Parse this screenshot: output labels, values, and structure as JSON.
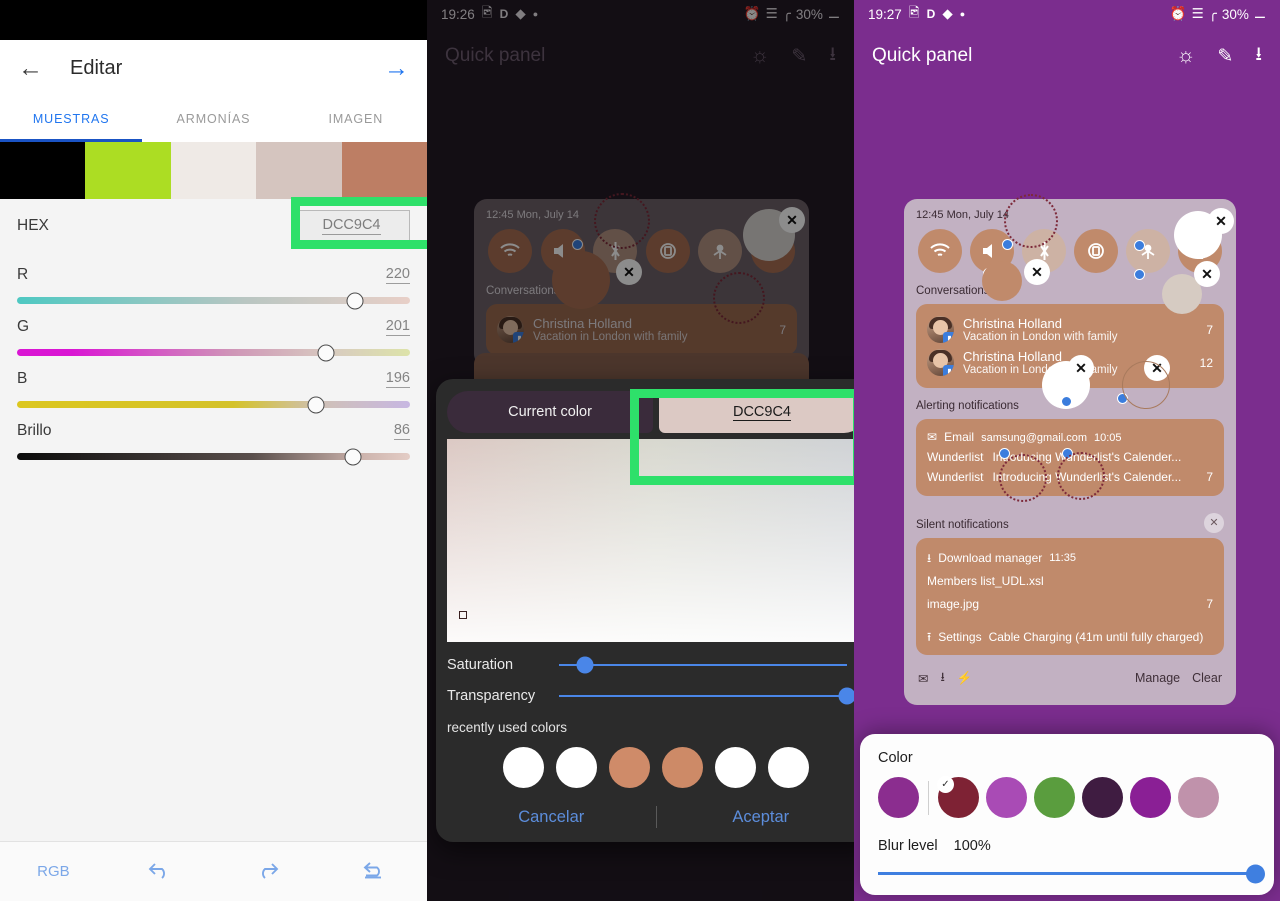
{
  "panel1": {
    "appbar": {
      "back_icon": "arrow-left-icon",
      "title": "Editar",
      "next_icon": "arrow-right-icon"
    },
    "tabs": [
      {
        "label": "MUESTRAS",
        "active": true
      },
      {
        "label": "ARMONÍAS",
        "active": false
      },
      {
        "label": "IMAGEN",
        "active": false
      }
    ],
    "swatches": [
      "#000000",
      "#acdd23",
      "#efeae6",
      "#d5c5bf",
      "#bd7e64"
    ],
    "hex": {
      "label": "HEX",
      "value": "DCC9C4"
    },
    "sliders": [
      {
        "label": "R",
        "value": "220",
        "pct": 86
      },
      {
        "label": "G",
        "value": "201",
        "pct": 78
      },
      {
        "label": "B",
        "value": "196",
        "pct": 76
      },
      {
        "label": "Brillo",
        "value": "86",
        "pct": 86
      }
    ],
    "bottom": {
      "mode_label": "RGB",
      "undo_icon": "undo-icon",
      "redo_icon": "redo-icon",
      "reset_icon": "reset-icon"
    }
  },
  "panel2": {
    "status": {
      "time": "19:26",
      "icons": [
        "image-icon",
        "D",
        "dropbox-icon",
        "dot-icon"
      ],
      "alarm_icon": "alarm-icon",
      "wifi_icon": "wifi-icon",
      "signal_icon": "signal-icon",
      "battery": "30%",
      "battery_icon": "battery-icon"
    },
    "header": {
      "title": "Quick panel",
      "brightness_icon": "brightness-icon",
      "edit_icon": "pencil-icon",
      "download_icon": "download-icon"
    },
    "quickpanel": {
      "date": "12:45 Mon, July 14",
      "tiles": [
        "wifi-icon",
        "sound-icon",
        "bluetooth-icon",
        "rotate-icon",
        "hotspot-icon",
        "flashlight-icon"
      ],
      "conversations_label": "Conversations",
      "conversations": [
        {
          "name": "Christina Holland",
          "sub": "Vacation in London with family",
          "count": "7"
        }
      ]
    },
    "dialog": {
      "current_label": "Current color",
      "new_value": "DCC9C4",
      "new_color": "#dcc9c4",
      "saturation": {
        "label": "Saturation",
        "pct": 9
      },
      "transparency": {
        "label": "Transparency",
        "pct": 100
      },
      "recent_label": "recently used colors",
      "recent_colors": [
        "#ffffff",
        "#ffffff",
        "#cf8b69",
        "#cd8a67",
        "#ffffff",
        "#ffffff"
      ],
      "cancel_label": "Cancelar",
      "accept_label": "Aceptar"
    }
  },
  "panel3": {
    "status": {
      "time": "19:27",
      "icons": [
        "image-icon",
        "D",
        "dropbox-icon",
        "dot-icon"
      ],
      "battery": "30%"
    },
    "header": {
      "title": "Quick panel",
      "brightness_icon": "brightness-icon",
      "edit_icon": "pencil-icon",
      "download_icon": "download-icon"
    },
    "quickpanel": {
      "date": "12:45 Mon, July 14",
      "conversations_label": "Conversations",
      "conversations": [
        {
          "name": "Christina Holland",
          "sub": "Vacation in London with family",
          "count": "7"
        },
        {
          "name": "Christina Holland",
          "sub": "Vacation in London with family",
          "count": "12"
        }
      ],
      "alerting_label": "Alerting notifications",
      "alerting": {
        "app_icon": "mail-icon",
        "app": "Email",
        "account": "samsung@gmail.com",
        "time": "10:05",
        "lines": [
          {
            "app": "Wunderlist",
            "text": "Introducing Wunderlist's Calender..."
          },
          {
            "app": "Wunderlist",
            "text": "Introducing Wunderlist's Calender..."
          }
        ],
        "count": "7"
      },
      "silent_label": "Silent notifications",
      "silent": {
        "app_icon": "download-icon",
        "app": "Download manager",
        "time": "11:35",
        "files": [
          "Members list_UDL.xsl",
          "image.jpg"
        ],
        "count": "7",
        "settings_icon": "upload-icon",
        "settings_app": "Settings",
        "settings_text": "Cable Charging (41m until fully charged)"
      },
      "footer": {
        "icons": [
          "mail-icon",
          "download-icon",
          "bolt-icon"
        ],
        "manage_label": "Manage",
        "clear_label": "Clear"
      }
    },
    "sheet": {
      "color_label": "Color",
      "colors": [
        "#8b2d8f",
        "#7e2234",
        "#a94bb5",
        "#5a9d3e",
        "#3f1c41",
        "#8a1f95",
        "#c092ab"
      ],
      "selected_index": 1,
      "blur_label": "Blur level",
      "blur_value": "100%",
      "blur_pct": 100
    }
  },
  "accent": {
    "green_highlight": "#2ee06a",
    "blue": "#3f7fe0",
    "purple": "#7b2d8e"
  }
}
